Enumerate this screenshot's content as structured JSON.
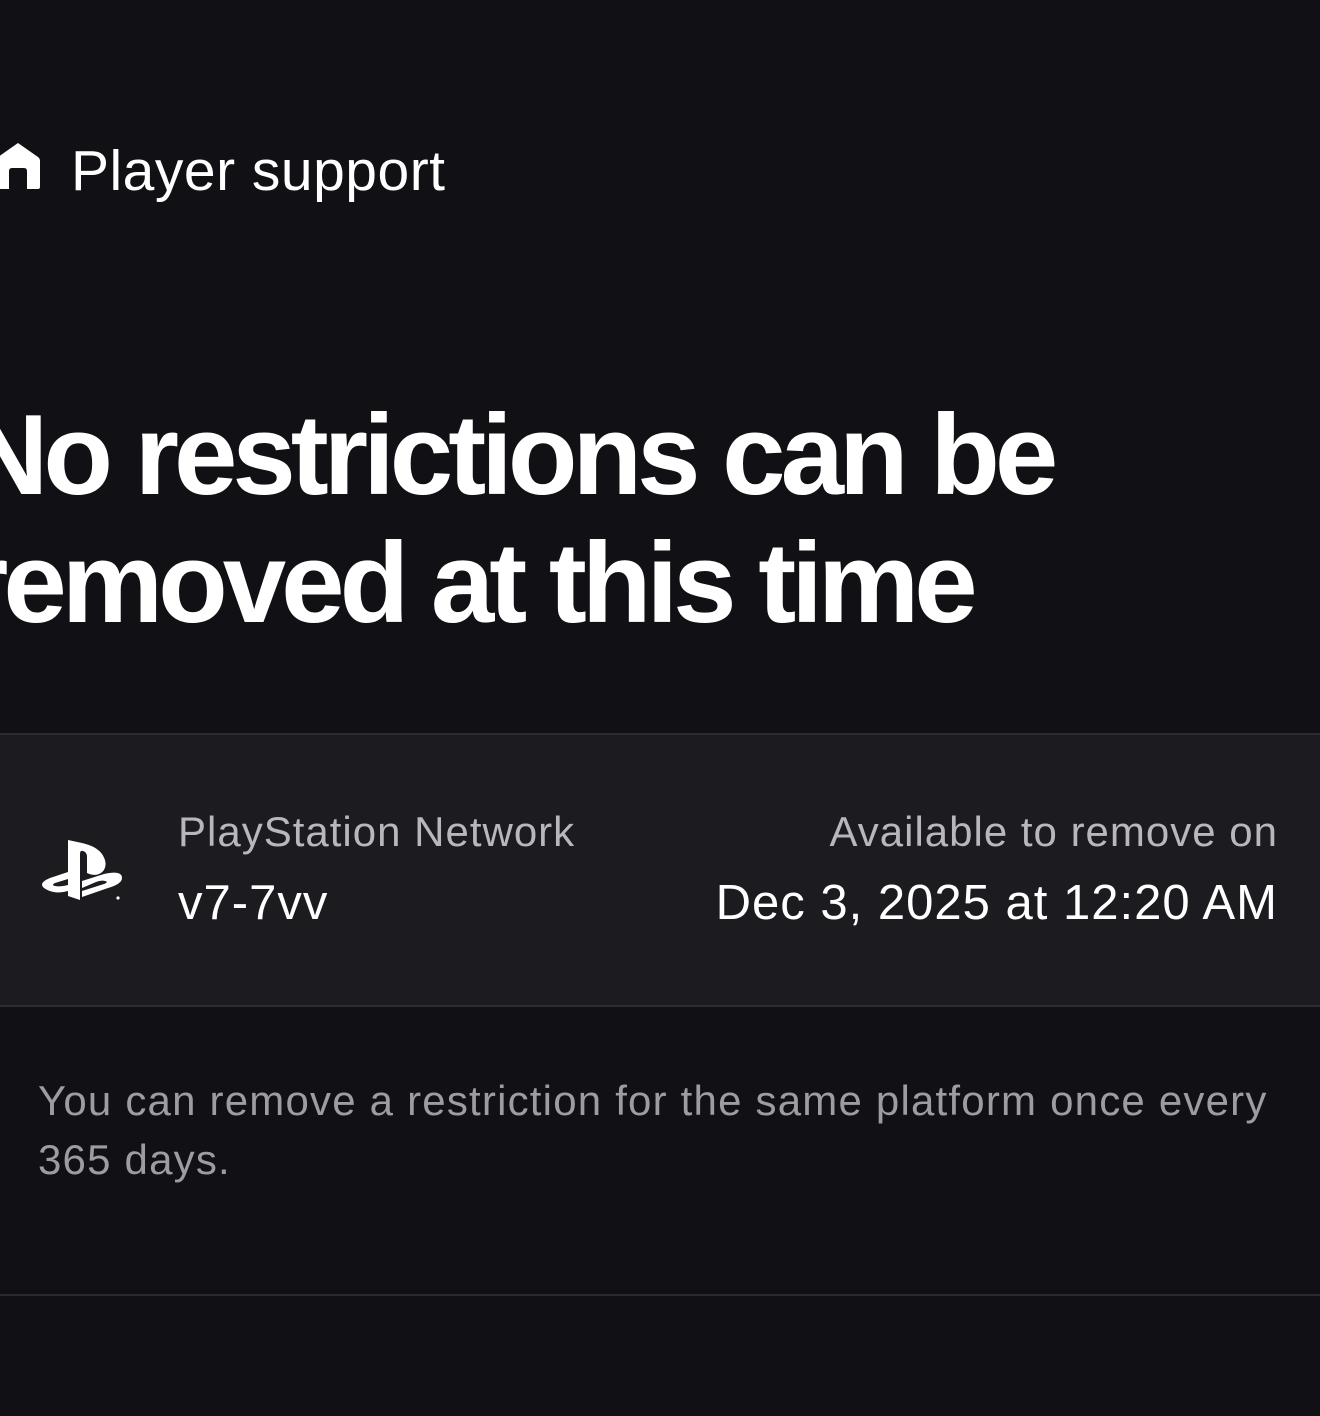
{
  "breadcrumb": {
    "icon": "home-icon",
    "label": "Player support"
  },
  "headline": {
    "line1": "No restrictions can be",
    "line2": "removed at this time"
  },
  "restriction_card": {
    "platform_icon": "playstation-icon",
    "platform_name": "PlayStation Network",
    "platform_id": "v7-7vv",
    "available_label": "Available to remove on",
    "available_date": "Dec 3, 2025 at 12:20 AM"
  },
  "note": {
    "line1": "You can remove a restriction for the same platform once every",
    "line2": "365 days."
  },
  "colors": {
    "background": "#111015",
    "card": "#1c1b20",
    "text_primary": "#ffffff",
    "text_secondary": "#b8b7bd",
    "text_muted": "#9d9ca3"
  }
}
